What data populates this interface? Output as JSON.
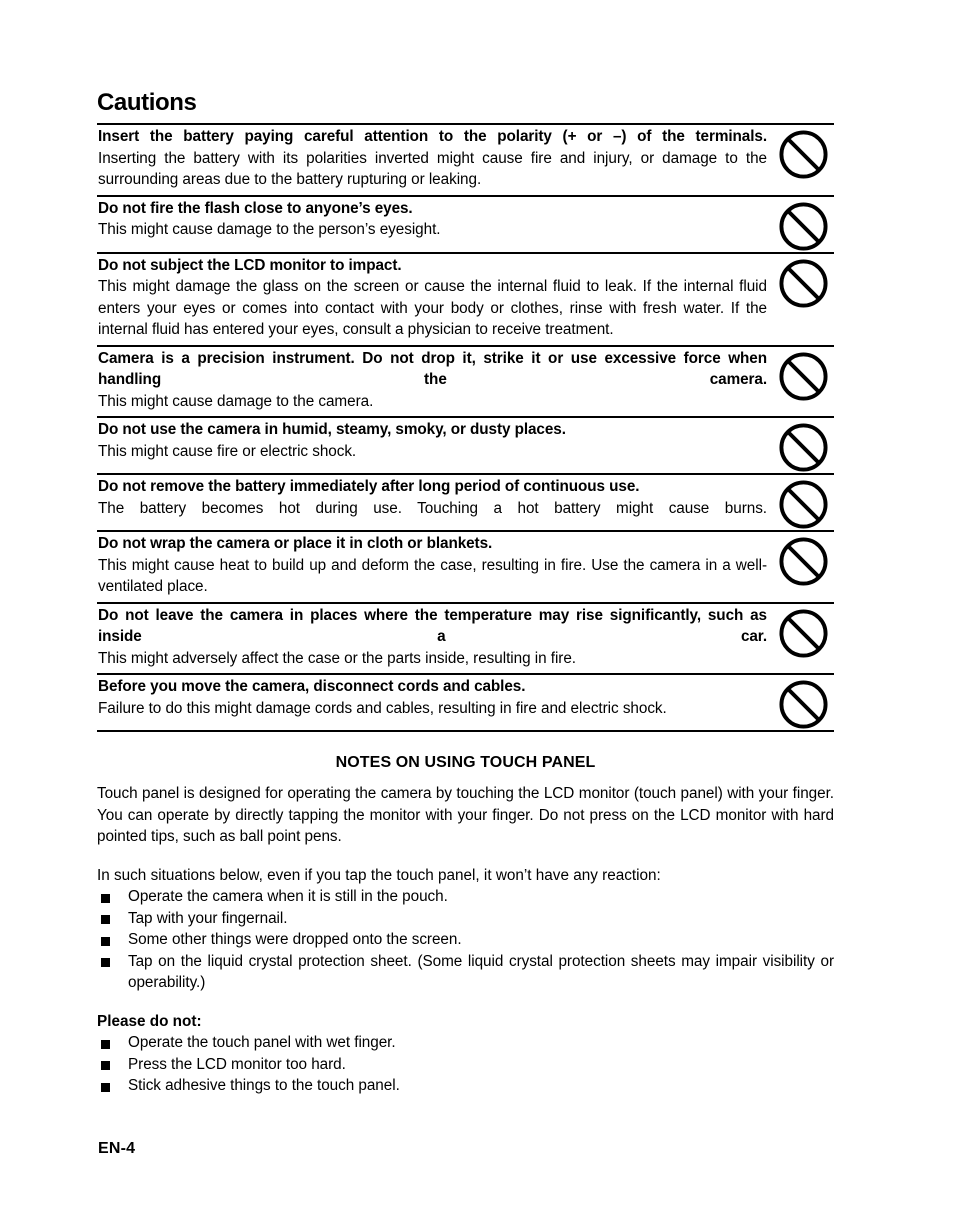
{
  "document": {
    "title": "Cautions",
    "footer_page_label": "EN-4"
  },
  "cautions": {
    "icon_name": "prohibition-icon",
    "rows": [
      {
        "heading": "Insert the battery paying careful attention to the polarity (+ or –) of the terminals.",
        "body": "Inserting the battery with its polarities inverted might cause fire and injury, or damage to the surrounding areas due to the battery rupturing or leaking."
      },
      {
        "heading": "Do not fire the flash close to anyone’s eyes.",
        "body": "This might cause damage to the person’s eyesight."
      },
      {
        "heading": "Do not subject the LCD monitor to impact.",
        "body": "This might damage the glass on the screen or cause the internal fluid to leak. If the internal fluid enters your eyes or comes into contact with your body or clothes, rinse with fresh water. If the internal fluid has entered your eyes, consult a physician to receive treatment."
      },
      {
        "heading": "Camera is a precision instrument. Do not drop it, strike it or use excessive force when handling the camera.",
        "body": "This might cause damage to the camera."
      },
      {
        "heading": "Do not use the camera in humid, steamy, smoky, or dusty places.",
        "body": "This might cause fire or electric shock."
      },
      {
        "heading": "Do not remove the battery immediately after long period of continuous use.",
        "body": "The battery becomes hot during use. Touching a hot battery might cause burns."
      },
      {
        "heading": "Do not wrap the camera or place it in cloth or blankets.",
        "body": "This might cause heat to build up and deform the case, resulting in fire. Use the camera in a well-ventilated place."
      },
      {
        "heading": "Do not leave the camera in places where the temperature may rise significantly, such as inside a car.",
        "body": "This might adversely affect the case or the parts inside, resulting in fire."
      },
      {
        "heading": "Before you move the camera, disconnect cords and cables.",
        "body": "Failure to do this might damage cords and cables, resulting in fire and electric shock."
      }
    ]
  },
  "touch_panel_notes": {
    "heading": "NOTES ON USING TOUCH PANEL",
    "intro_paragraph": "Touch panel is designed for operating the camera by touching the LCD monitor (touch panel) with your finger. You can operate by directly tapping the monitor with your finger. Do not press on the LCD monitor with hard pointed tips, such as ball point pens.",
    "no_reaction_lead": "In such situations below, even if you tap the touch panel, it won’t have any reaction:",
    "no_reaction_items": [
      "Operate the camera when it is still in the pouch.",
      "Tap with your fingernail.",
      "Some other things were dropped onto the screen.",
      "Tap on the liquid crystal protection sheet. (Some liquid crystal protection sheets may impair visibility or operability.)"
    ],
    "please_do_not_heading": "Please do not:",
    "please_do_not_items": [
      "Operate the touch panel with wet finger.",
      "Press the LCD monitor too hard.",
      "Stick adhesive things to the touch panel."
    ]
  }
}
